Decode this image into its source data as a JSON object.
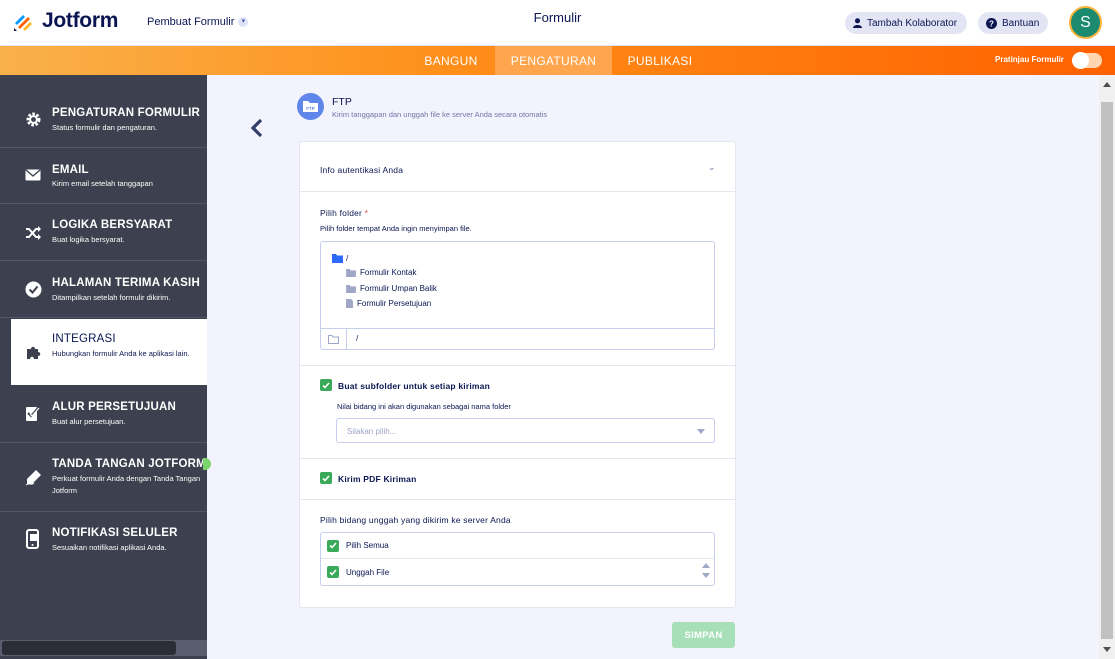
{
  "header": {
    "logo_text": "Jotform",
    "maker_label": "Pembuat Formulir",
    "form_title": "Formulir",
    "collab_label": "Tambah Kolaborator",
    "help_label": "Bantuan",
    "avatar_letter": "S"
  },
  "nav": {
    "tabs": [
      {
        "label": "BANGUN"
      },
      {
        "label": "PENGATURAN"
      },
      {
        "label": "PUBLIKASI"
      }
    ],
    "preview_label": "Pratinjau Formulir"
  },
  "sidebar": {
    "items": [
      {
        "title": "PENGATURAN FORMULIR",
        "desc": "Status formulir dan pengaturan."
      },
      {
        "title": "EMAIL",
        "desc": "Kirim email setelah tanggapan"
      },
      {
        "title": "LOGIKA BERSYARAT",
        "desc": "Buat logika bersyarat."
      },
      {
        "title": "HALAMAN TERIMA KASIH",
        "desc": "Ditampilkan setelah formulir dikirim."
      },
      {
        "title": "INTEGRASI",
        "desc": "Hubungkan formulir Anda ke aplikasi lain."
      },
      {
        "title": "ALUR PERSETUJUAN",
        "desc": "Buat alur persetujuan."
      },
      {
        "title": "TANDA TANGAN JOTFORM",
        "desc": "Perkuat formulir Anda dengan Tanda Tangan Jotform"
      },
      {
        "title": "NOTIFIKASI SELULER",
        "desc": "Sesuaikan notifikasi aplikasi Anda."
      }
    ]
  },
  "ftp": {
    "title": "FTP",
    "subtitle": "Kirim tanggapan dan unggah file ke server Anda secara otomatis"
  },
  "auth": {
    "label": "Info autentikasi Anda"
  },
  "folder": {
    "label": "Pilih folder",
    "required": "*",
    "hint": "Pilih folder tempat Anda ingin menyimpan file.",
    "root": "/",
    "children": [
      "Formulir Kontak",
      "Formulir Umpan Balik",
      "Formulir Persetujuan"
    ],
    "path": "/"
  },
  "subfolder": {
    "label": "Buat subfolder untuk setiap kiriman",
    "hint": "Nilai bidang ini akan digunakan sebagai nama folder",
    "placeholder": "Silakan pilih..."
  },
  "pdf": {
    "label": "Kirim PDF Kiriman"
  },
  "upload": {
    "label": "Pilih bidang unggah yang dikirim ke server Anda",
    "options": [
      "Pilih Semua",
      "Unggah File"
    ]
  },
  "save_label": "SIMPAN",
  "colors": {
    "brand_orange": "#ff6100",
    "navy": "#0a1551",
    "sidebar_bg": "#3d404e",
    "check_green": "#3aa959",
    "save_disabled": "#a7dfb8"
  }
}
